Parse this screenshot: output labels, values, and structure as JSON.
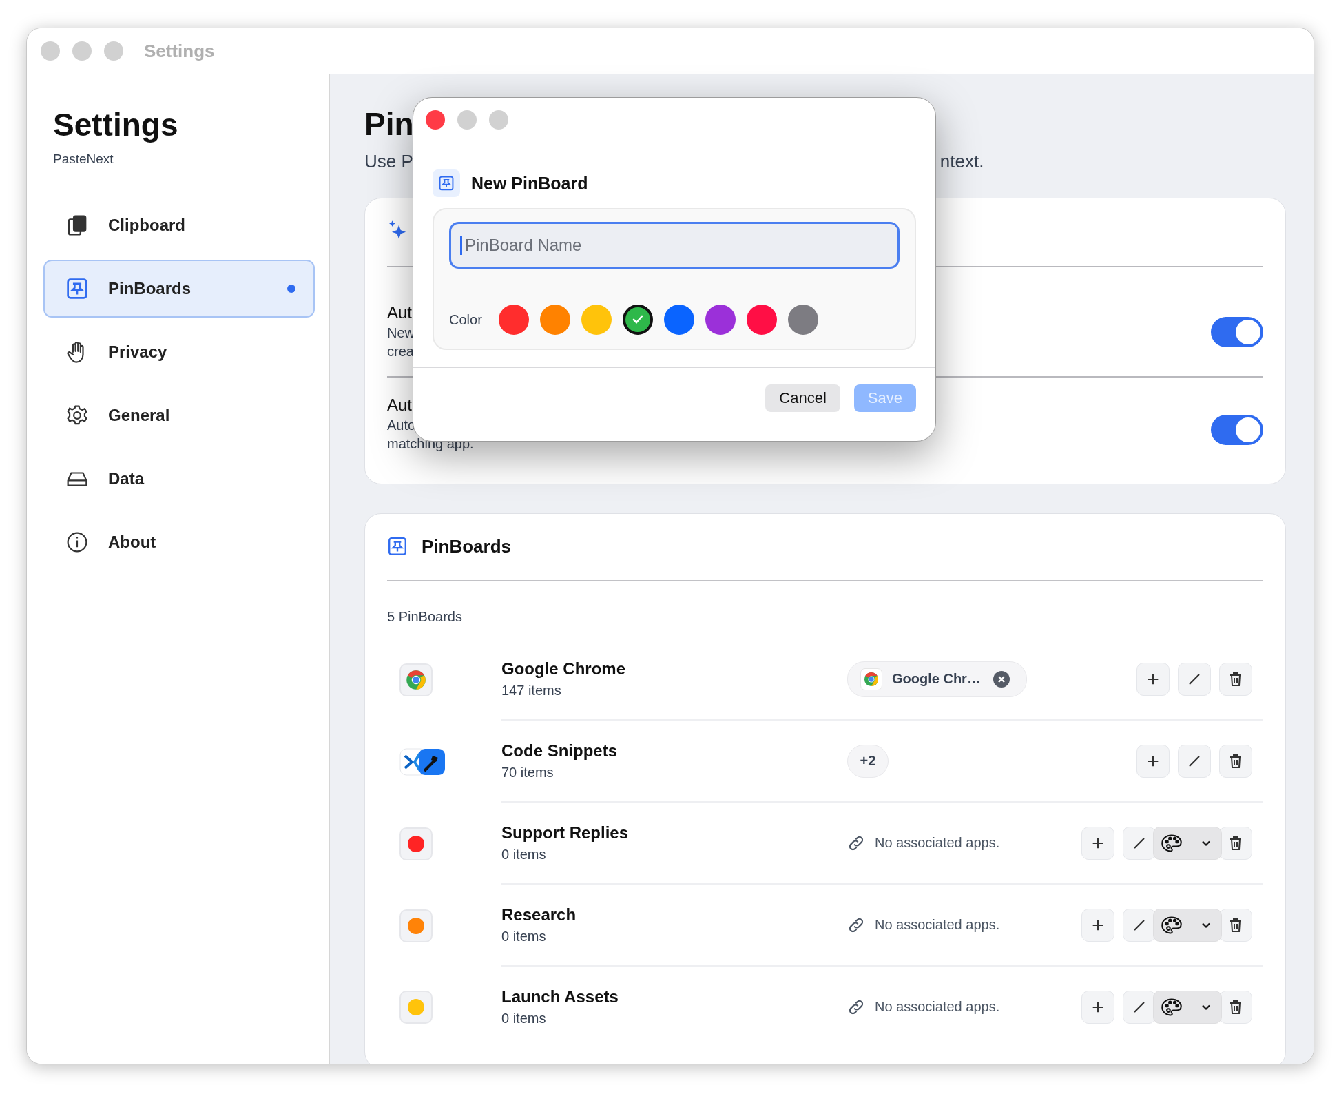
{
  "window": {
    "title": "Settings"
  },
  "sidebar": {
    "title": "Settings",
    "subtitle": "PasteNext",
    "items": [
      {
        "label": "Clipboard",
        "kind": "clipboard",
        "selected": false,
        "dot": false
      },
      {
        "label": "PinBoards",
        "kind": "pinboards",
        "selected": true,
        "dot": true
      },
      {
        "label": "Privacy",
        "kind": "privacy",
        "selected": false,
        "dot": false
      },
      {
        "label": "General",
        "kind": "general",
        "selected": false,
        "dot": false
      },
      {
        "label": "Data",
        "kind": "data",
        "selected": false,
        "dot": false
      },
      {
        "label": "About",
        "kind": "about",
        "selected": false,
        "dot": false
      }
    ]
  },
  "page": {
    "title": "Pin",
    "subtitle_left": "Use P",
    "subtitle_right": "ntext."
  },
  "auto_card": {
    "rows": [
      {
        "title": "Aut",
        "description": [
          "New",
          "crea"
        ],
        "on": true
      },
      {
        "title": "Aut",
        "description": [
          "Auto",
          "matching app."
        ],
        "on": true
      }
    ]
  },
  "pinboards_card": {
    "title": "PinBoards",
    "count": "5 PinBoards",
    "rows": [
      {
        "kind": "chrome-app",
        "name": "Google Chrome",
        "items": "147 items",
        "apps": {
          "kind": "chip",
          "label": "Google Chr…"
        }
      },
      {
        "kind": "multi-app",
        "name": "Code Snippets",
        "items": "70 items",
        "apps": {
          "kind": "more",
          "label": "+2"
        }
      },
      {
        "kind": "color",
        "color": "#ff2424",
        "name": "Support Replies",
        "items": "0 items",
        "apps": {
          "kind": "none",
          "label": "No associated apps."
        }
      },
      {
        "kind": "color",
        "color": "#ff8308",
        "name": "Research",
        "items": "0 items",
        "apps": {
          "kind": "none",
          "label": "No associated apps."
        }
      },
      {
        "kind": "color",
        "color": "#ffc30b",
        "name": "Launch Assets",
        "items": "0 items",
        "apps": {
          "kind": "none",
          "label": "No associated apps."
        }
      }
    ]
  },
  "dialog": {
    "title": "New PinBoard",
    "placeholder": "PinBoard Name",
    "color_label": "Color",
    "colors": [
      {
        "color": "#ff2d2d",
        "selected": false
      },
      {
        "color": "#ff8200",
        "selected": false
      },
      {
        "color": "#ffc30b",
        "selected": false
      },
      {
        "color": "#2eb84a",
        "selected": true
      },
      {
        "color": "#0a64ff",
        "selected": false
      },
      {
        "color": "#9b30d9",
        "selected": false
      },
      {
        "color": "#ff0f45",
        "selected": false
      },
      {
        "color": "#7d7c82",
        "selected": false
      }
    ],
    "buttons": [
      {
        "label": "Cancel",
        "kind": "secondary",
        "disabled": false
      },
      {
        "label": "Save",
        "kind": "primary",
        "disabled": true
      }
    ]
  }
}
